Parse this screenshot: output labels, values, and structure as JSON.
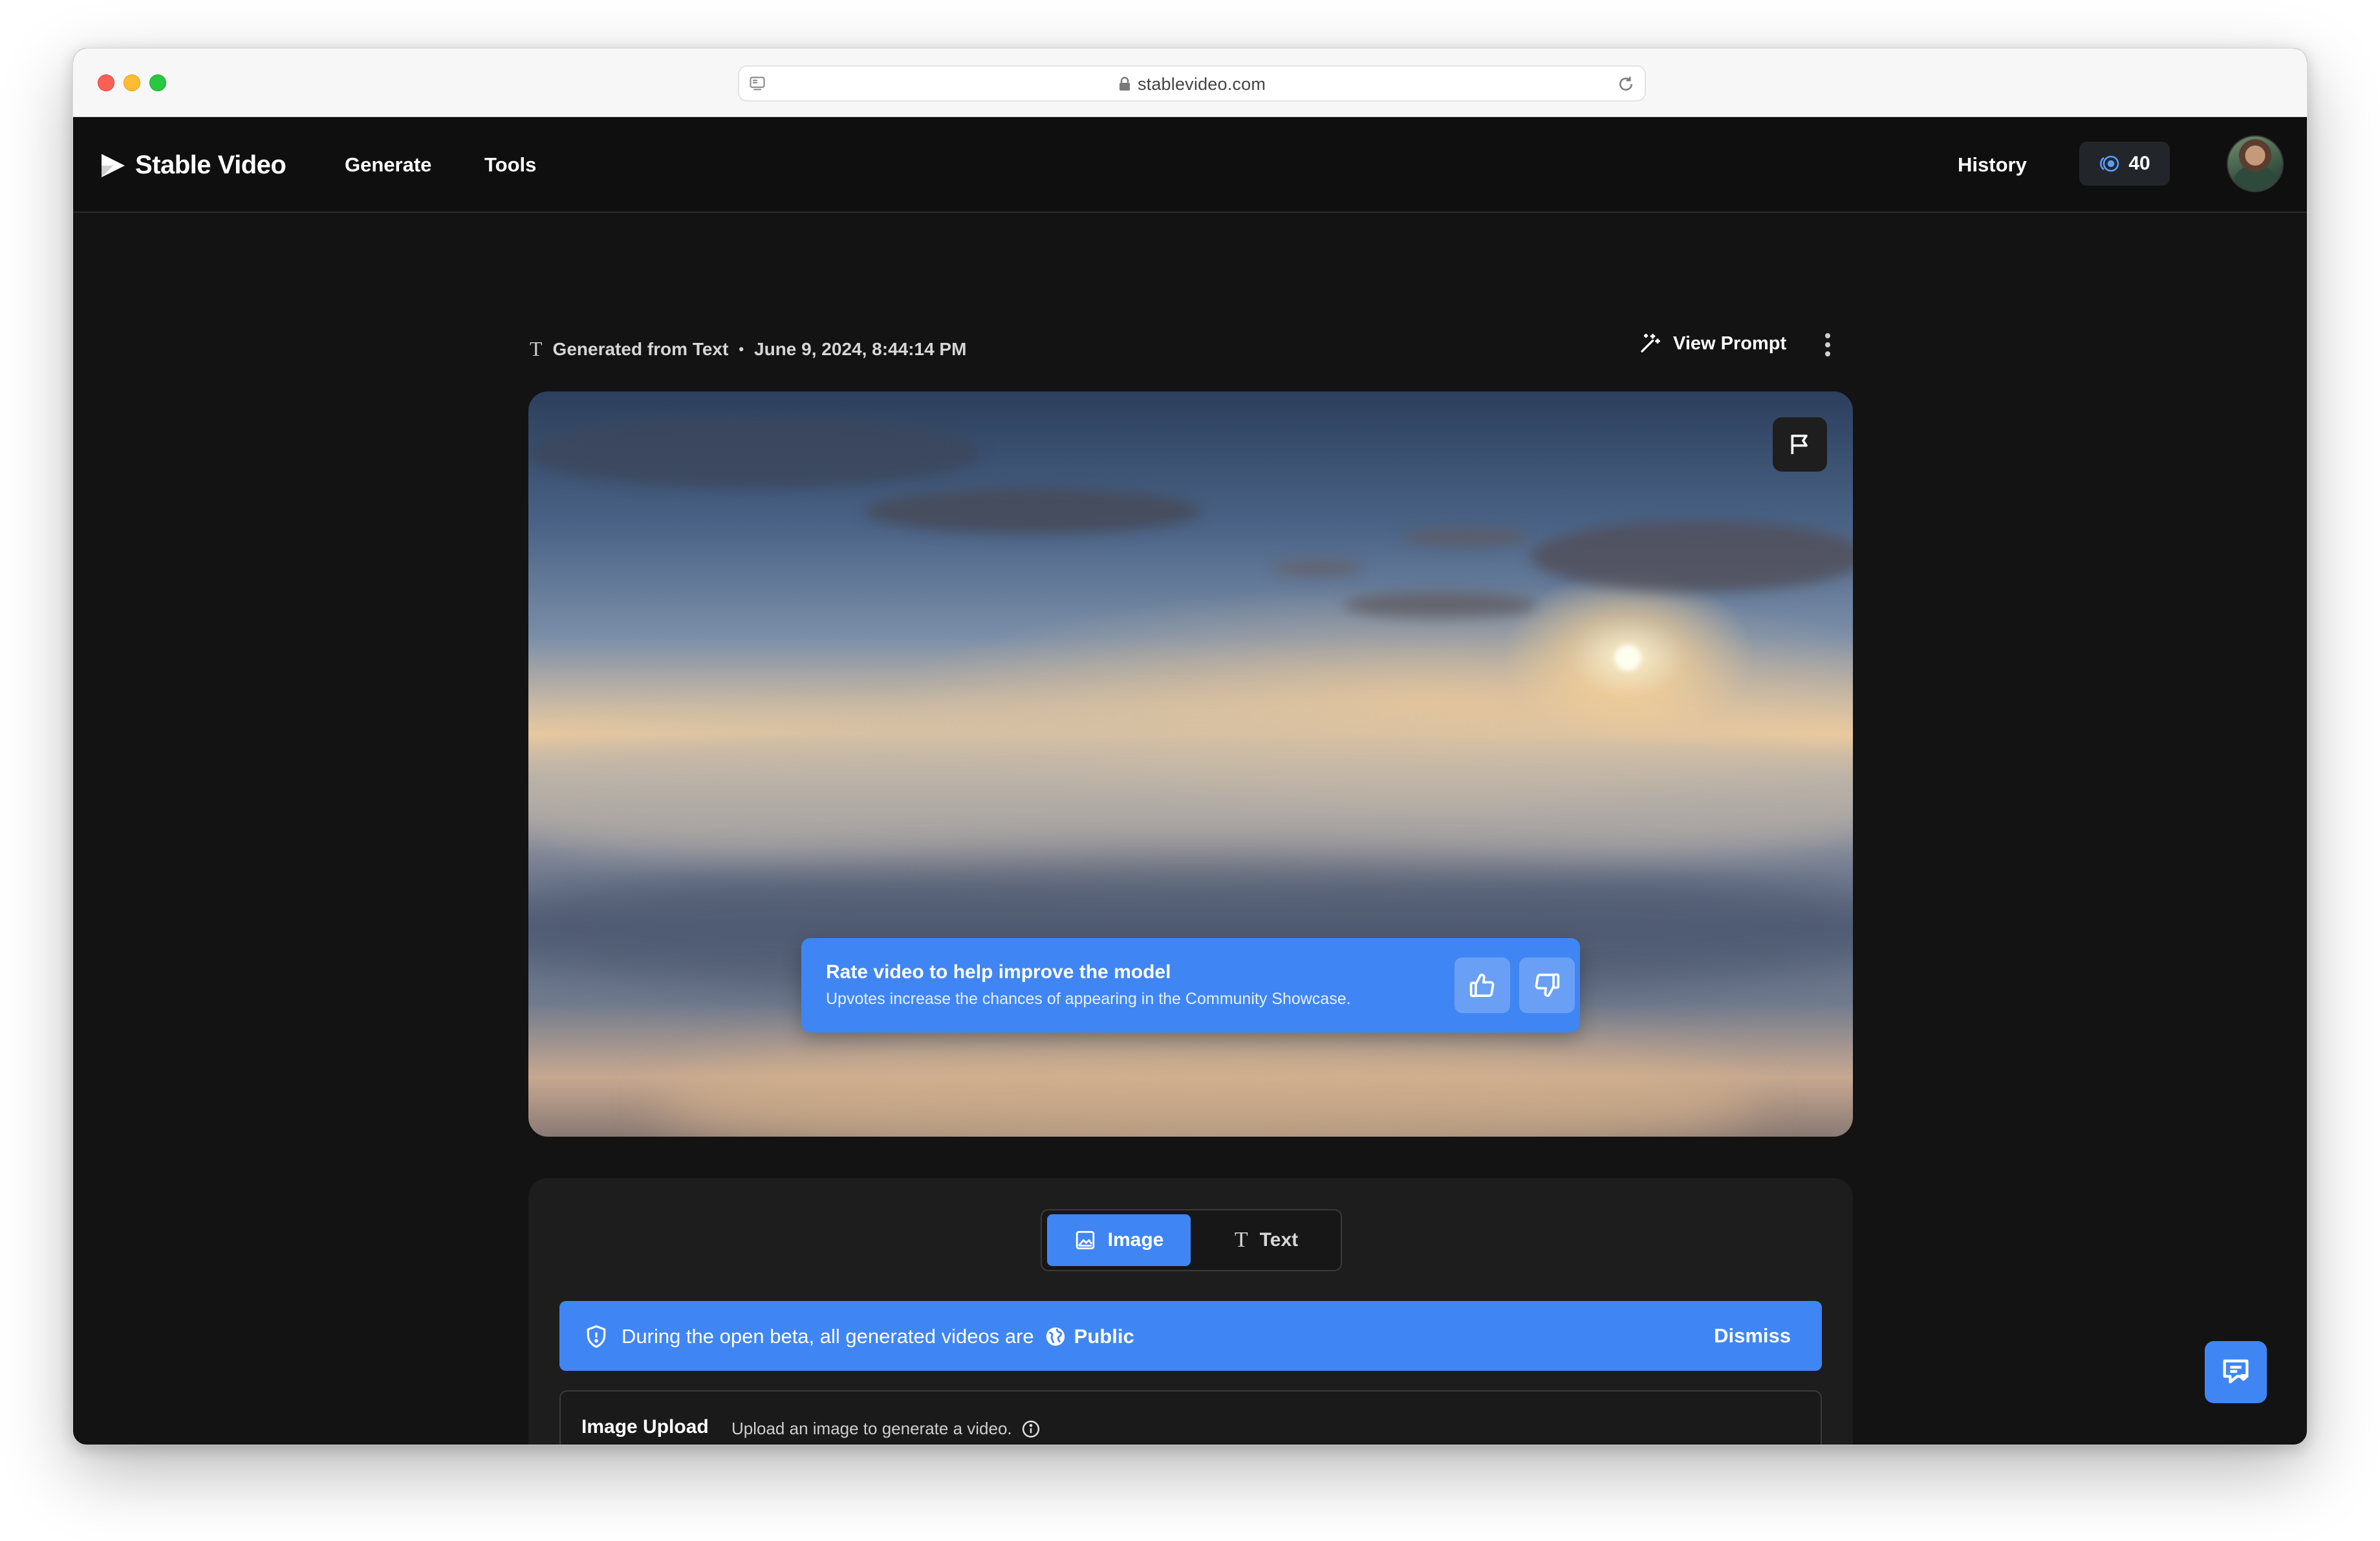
{
  "browser": {
    "url": "stablevideo.com"
  },
  "header": {
    "brand": "Stable Video",
    "nav": {
      "generate": "Generate",
      "tools": "Tools",
      "history": "History"
    },
    "credits": "40"
  },
  "meta": {
    "source": "Generated from Text",
    "separator": "•",
    "timestamp": "June 9, 2024, 8:44:14 PM",
    "view_prompt": "View Prompt"
  },
  "rating": {
    "title": "Rate video to help improve the model",
    "subtitle": "Upvotes increase the chances of appearing in the Community Showcase."
  },
  "panel": {
    "tabs": {
      "image": "Image",
      "text": "Text"
    },
    "banner": {
      "message": "During the open beta, all generated videos are",
      "visibility": "Public",
      "dismiss": "Dismiss"
    },
    "upload": {
      "title": "Image Upload",
      "description": "Upload an image to generate a video."
    }
  },
  "colors": {
    "accent": "#3f86f4",
    "background": "#131313",
    "panel": "#1d1d1d"
  }
}
